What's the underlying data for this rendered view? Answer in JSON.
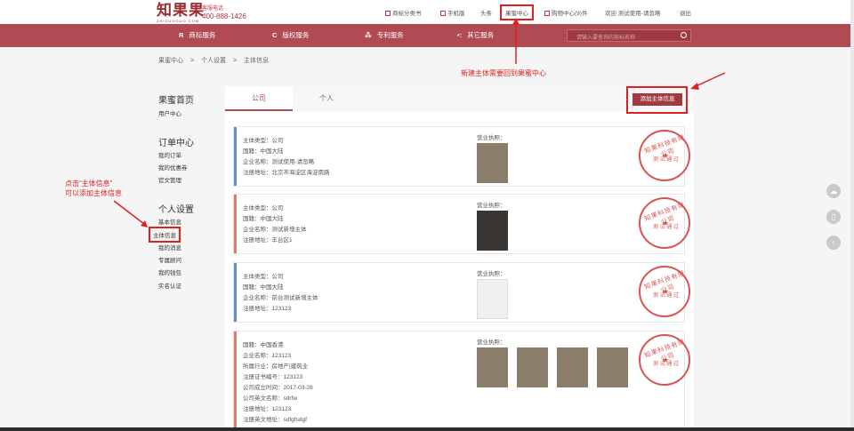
{
  "header": {
    "logo": "知果果",
    "logo_sub": "ZHIGUOGUO.COM",
    "hotline_label": "客服电话",
    "phone": "400-888-1426",
    "links": {
      "trademark_class": "商标分类书",
      "mobile": "手机版",
      "headlines": "头条",
      "guomi_center": "果蜜中心",
      "cart": "购物中心(9)件",
      "welcome": "欢迎 测试使用-请忽略",
      "logout": "退出"
    }
  },
  "nav": {
    "items": [
      {
        "icon": "R",
        "label": "商标服务"
      },
      {
        "icon": "C",
        "label": "版权服务"
      },
      {
        "icon": "⁂",
        "label": "专利服务"
      },
      {
        "icon": "•:",
        "label": "其它服务"
      }
    ],
    "search_placeholder": "请输入要查询的商标名称"
  },
  "breadcrumb": [
    "果蜜中心",
    ">",
    "个人设置",
    ">",
    "主体信息"
  ],
  "sidebar": {
    "home_head": "果蜜首页",
    "home_items": [
      "用户中心"
    ],
    "order_head": "订单中心",
    "order_items": [
      "我的订单",
      "我的优惠券",
      "官文管理"
    ],
    "settings_head": "个人设置",
    "settings_items": [
      "基本信息",
      "主体信息",
      "我的消息",
      "专属顾问",
      "我的钱包",
      "实名认证"
    ]
  },
  "tabs": [
    "公司",
    "个人"
  ],
  "add_button": "添加主体信息",
  "license_label": "营业执照：",
  "seal": {
    "text": "知果科技有限公司",
    "middle": "测 试 通 过"
  },
  "cards": [
    {
      "color": "#6b8fc4",
      "lines": [
        "主体类型：公司",
        "国籍：中国大陆",
        "企业名称：测试使用-请忽略",
        "注册地址：北京市海淀区海淀南路"
      ]
    },
    {
      "color": "#e07a6a",
      "lines": [
        "主体类型：公司",
        "国籍：中国大陆",
        "企业名称：测试新增主体",
        "注册地址：丰台区1"
      ]
    },
    {
      "color": "#6b8fc4",
      "lines": [
        "主体类型：公司",
        "国籍：中国大陆",
        "企业名称：前台测试新增主体",
        "注册地址：123123"
      ]
    },
    {
      "color": "#e07a6a",
      "lines": [
        "国籍：中国香港",
        "企业名称：123123",
        "所属行业：房地产|建筑业",
        "注册证书编号：123123",
        "公司成立时间：2017-03-28",
        "公司英文名称：sdrfw",
        "注册地址：123123",
        "注册英文地址：sdfgfsdgf"
      ]
    }
  ],
  "annotations": {
    "top": "新建主体需要回到果蜜中心",
    "left_line1": "点击“主体信息”",
    "left_line2": "可以添加主体信息"
  },
  "colors": {
    "brand": "#b14a53",
    "annotation": "#e02020"
  }
}
